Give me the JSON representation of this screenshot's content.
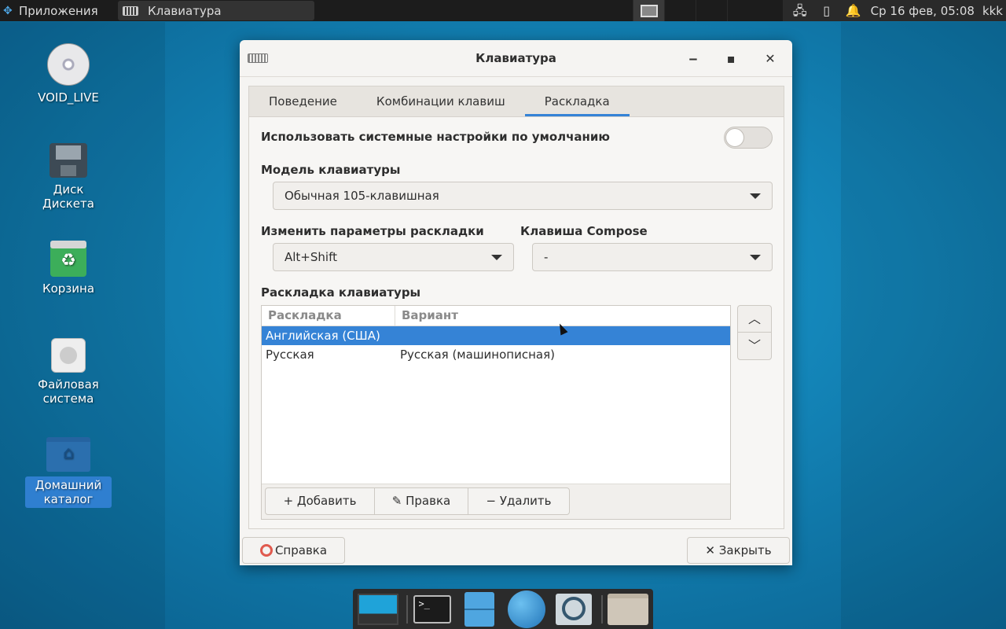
{
  "top_panel": {
    "apps_label": "Приложения",
    "task_title": "Клавиатура",
    "clock": "Ср 16 фев, 05:08",
    "user": "kkk"
  },
  "desktop": {
    "icons": [
      {
        "label": "VOID_LIVE"
      },
      {
        "label": "Диск Дискета"
      },
      {
        "label": "Корзина"
      },
      {
        "label": "Файловая система"
      },
      {
        "label": "Домашний каталог"
      }
    ]
  },
  "dialog": {
    "title": "Клавиатура",
    "tabs": [
      "Поведение",
      "Комбинации клавиш",
      "Раскладка"
    ],
    "active_tab": "Раскладка",
    "use_system_defaults_label": "Использовать системные настройки по умолчанию",
    "use_system_defaults_on": false,
    "model_label": "Модель клавиатуры",
    "model_value": "Обычная 105-клавишная",
    "change_layout_label": "Изменить параметры раскладки",
    "change_layout_value": "Alt+Shift",
    "compose_label": "Клавиша Compose",
    "compose_value": "-",
    "layout_list_label": "Раскладка клавиатуры",
    "columns": [
      "Раскладка",
      "Вариант"
    ],
    "rows": [
      {
        "layout": "Английская (США)",
        "variant": "",
        "selected": true
      },
      {
        "layout": "Русская",
        "variant": "Русская (машинописная)",
        "selected": false
      }
    ],
    "add_label": "Добавить",
    "edit_label": "Правка",
    "remove_label": "Удалить",
    "help_label": "Справка",
    "close_label": "Закрыть"
  },
  "colors": {
    "accent": "#3583d6",
    "panel_bg": "#1c1c1c"
  }
}
